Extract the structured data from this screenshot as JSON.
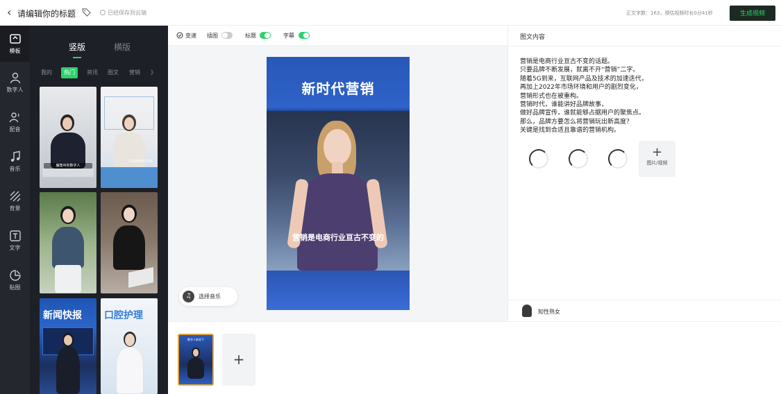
{
  "header": {
    "title": "请编辑你的标题",
    "save_status": "已经保存到云端",
    "word_count": "正文字数：163，预估视频时长0分41秒",
    "generate_button": "生成视频"
  },
  "rail": {
    "items": [
      {
        "label": "模板",
        "icon": "template-icon"
      },
      {
        "label": "数字人",
        "icon": "person-icon"
      },
      {
        "label": "配音",
        "icon": "voice-icon"
      },
      {
        "label": "音乐",
        "icon": "music-icon"
      },
      {
        "label": "背景",
        "icon": "background-icon"
      },
      {
        "label": "文字",
        "icon": "text-icon"
      },
      {
        "label": "贴图",
        "icon": "sticker-icon"
      }
    ]
  },
  "panel": {
    "orientation_tabs": [
      "竖版",
      "横版"
    ],
    "active_orientation": "竖版",
    "categories": [
      "我的",
      "热门",
      "资讯",
      "图文",
      "营销",
      "》"
    ],
    "active_category": "热门",
    "thumbs": [
      {
        "caption": "魔角叫你数字人"
      },
      {
        "caption": "",
        "subcaption": "CELEBRATION"
      },
      {
        "caption": ""
      },
      {
        "caption": ""
      },
      {
        "headline": "新闻快报",
        "caption": ""
      },
      {
        "headline": "口腔护理",
        "caption": ""
      }
    ]
  },
  "toolbar": {
    "toggles": [
      {
        "label": "变速",
        "on": null
      },
      {
        "label": "插图",
        "on": false
      },
      {
        "label": "标题",
        "on": true
      },
      {
        "label": "字幕",
        "on": true
      }
    ]
  },
  "preview": {
    "title": "新时代营销",
    "caption": "营销是电商行业亘古不变的",
    "music_button": "选择音乐"
  },
  "script_panel": {
    "heading": "图文内容",
    "lines": [
      "营销是电商行业亘古不变的话题。",
      "只要品牌不断发展，就离不开“营销”二字。",
      "随着5G到来，互联网产品及技术的加速迭代，",
      "再加上2022年市场环境和用户的剧烈变化，",
      "营销形式也在被重构。",
      "营销时代，谁能讲好品牌故事，",
      "做好品牌宣传，谁就能够占据用户的聚焦点。",
      "那么，品牌方要怎么将营销玩出新高度？",
      "关键是找到合适且靠谱的营销机构。"
    ],
    "add_media_label": "图片/视频",
    "voice_name": "知性熟女"
  },
  "timeline": {
    "scene_title": "数字人新关下"
  },
  "colors": {
    "accent": "#2fd06e",
    "dark_panel": "#1d2026",
    "rail": "#24272e",
    "preview_blue": "#2e63c9"
  }
}
